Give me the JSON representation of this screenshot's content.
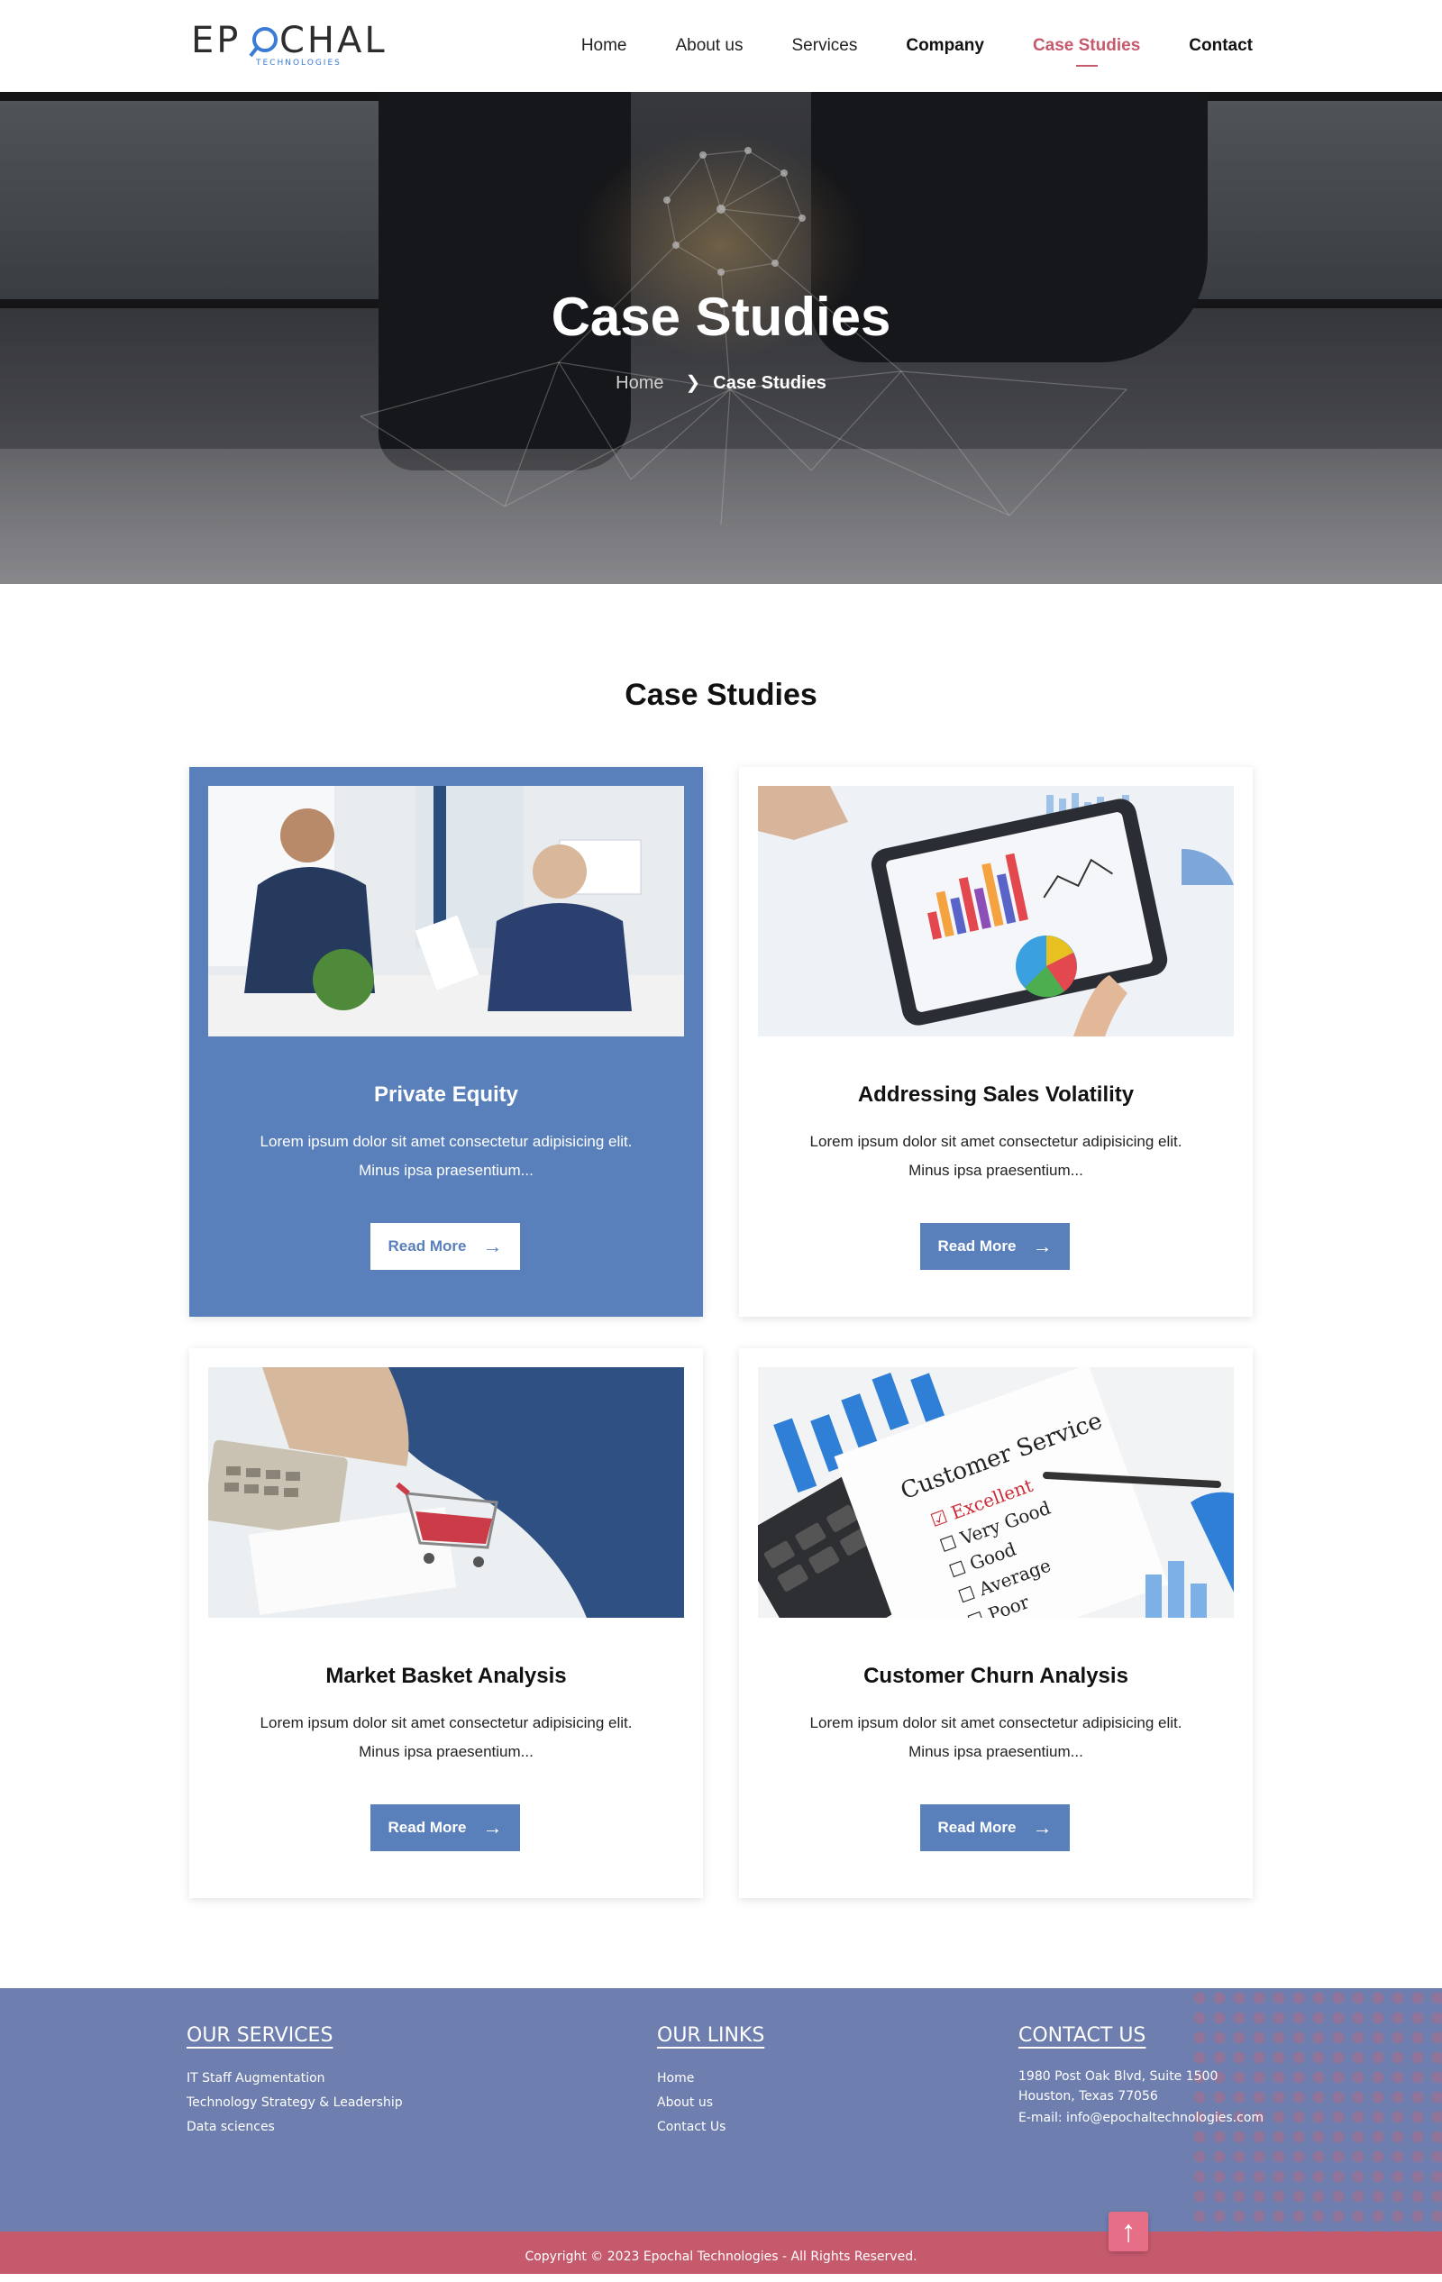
{
  "brand": {
    "logo_text": "EPCHAL",
    "logo_sub": "TECHNOLOGIES",
    "colors": {
      "accent": "#c55a6d",
      "primary": "#5a80bb",
      "footer": "#6e7eae"
    }
  },
  "nav": {
    "items": [
      {
        "label": "Home"
      },
      {
        "label": "About us"
      },
      {
        "label": "Services"
      },
      {
        "label": "Company"
      },
      {
        "label": "Case Studies",
        "active": true
      },
      {
        "label": "Contact"
      }
    ]
  },
  "hero": {
    "title": "Case Studies",
    "breadcrumb": {
      "home": "Home",
      "separator": ">",
      "current": "Case Studies"
    }
  },
  "section": {
    "title": "Case Studies"
  },
  "cards": [
    {
      "title": "Private Equity",
      "text": "Lorem ipsum dolor sit amet consectetur adipisicing elit. Minus ipsa praesentium...",
      "button": "Read More",
      "featured": true,
      "image_icon": "business-meeting-image"
    },
    {
      "title": "Addressing Sales Volatility",
      "text": "Lorem ipsum dolor sit amet consectetur adipisicing elit. Minus ipsa praesentium...",
      "button": "Read More",
      "featured": false,
      "image_icon": "tablet-charts-image"
    },
    {
      "title": "Market Basket Analysis",
      "text": "Lorem ipsum dolor sit amet consectetur adipisicing elit. Minus ipsa praesentium...",
      "button": "Read More",
      "featured": false,
      "image_icon": "shopping-cart-image"
    },
    {
      "title": "Customer Churn Analysis",
      "text": "Lorem ipsum dolor sit amet consectetur adipisicing elit. Minus ipsa praesentium...",
      "button": "Read More",
      "featured": false,
      "image_icon": "customer-survey-image"
    }
  ],
  "footer": {
    "services": {
      "heading": "OUR SERVICES",
      "items": [
        "IT Staff Augmentation",
        "Technology Strategy & Leadership",
        "Data sciences"
      ]
    },
    "links": {
      "heading": "OUR LINKS",
      "items": [
        "Home",
        "About us",
        "Contact Us"
      ]
    },
    "contact": {
      "heading": "CONTACT US",
      "address1": "1980 Post Oak Blvd, Suite 1500",
      "address2": "Houston, Texas 77056",
      "email": "E-mail: info@epochaltechnologies.com"
    },
    "copyright": "Copyright © 2023 Epochal Technologies - All Rights Reserved.",
    "to_top_icon": "arrow-up-icon"
  }
}
